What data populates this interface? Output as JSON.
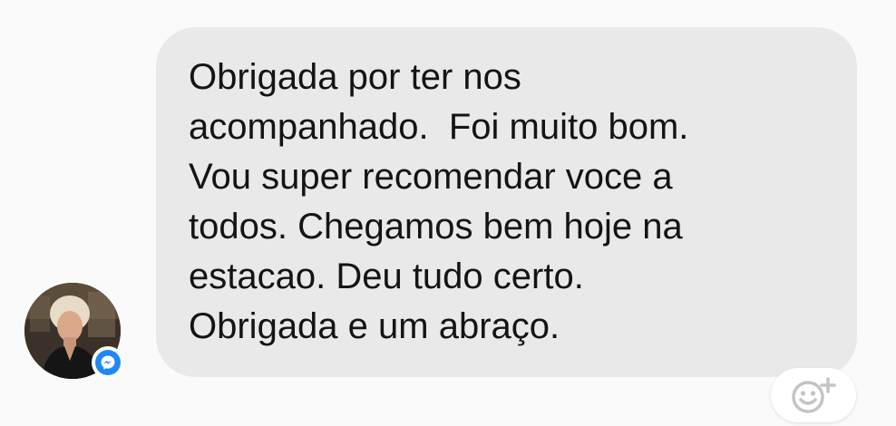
{
  "conversation": {
    "message": {
      "text": "Obrigada por ter nos\nacompanhado.  Foi muito bom.\nVou super recomendar voce a\ntodos. Chegamos bem hoje na\nestacao. Deu tudo certo.\nObrigada e um abraço."
    },
    "sender": {
      "avatar_icon": "profile-photo",
      "badge_icon": "messenger-icon"
    },
    "reaction": {
      "icon": "add-reaction-icon"
    }
  },
  "colors": {
    "background": "#fafafa",
    "bubble": "#e9e9e9",
    "text": "#141414",
    "messenger_blue": "#1e88f5",
    "reaction_icon": "#c4c4c4"
  }
}
